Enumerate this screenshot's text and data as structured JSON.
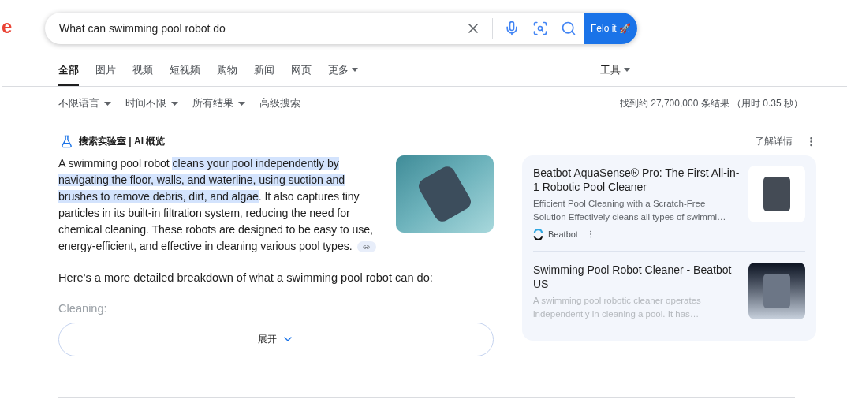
{
  "logo": "e",
  "search": {
    "value": "What can swimming pool robot do",
    "button": "Felo it 🚀"
  },
  "tabs": [
    {
      "label": "全部",
      "selected": true
    },
    {
      "label": "图片",
      "selected": false
    },
    {
      "label": "视频",
      "selected": false
    },
    {
      "label": "短视频",
      "selected": false
    },
    {
      "label": "购物",
      "selected": false
    },
    {
      "label": "新闻",
      "selected": false
    },
    {
      "label": "网页",
      "selected": false
    },
    {
      "label": "更多",
      "selected": false,
      "dropdown": true
    }
  ],
  "tools": "工具",
  "filters": [
    {
      "label": "不限语言",
      "dropdown": true
    },
    {
      "label": "时间不限",
      "dropdown": true
    },
    {
      "label": "所有结果",
      "dropdown": true
    },
    {
      "label": "高级搜索",
      "dropdown": false
    }
  ],
  "result_stats": "找到约 27,700,000 条结果 （用时 0.35 秒）",
  "ai_overview": {
    "title": "搜索实验室 | AI 概览",
    "learn_more": "了解详情",
    "segments": [
      {
        "text": "A swimming pool robot ",
        "highlighted": false
      },
      {
        "text": "cleans your pool independently by navigating the floor, walls, and waterline, using suction and brushes to remove debris, dirt, and algae",
        "highlighted": true
      },
      {
        "text": ". It also captures tiny particles in its built-in filtration system, reducing the need for chemical cleaning. These robots are designed to be easy to use, energy-efficient, and effective in cleaning various pool types.",
        "highlighted": false
      }
    ],
    "detail": "Here's a more detailed breakdown of what a swimming pool robot can do:",
    "faded_heading": "Cleaning:",
    "expand": "展开"
  },
  "sources": [
    {
      "title": "Beatbot AquaSense® Pro: The First All-in-1 Robotic Pool Cleaner",
      "snippet": "Efficient Pool Cleaning with a Scratch-Free Solution Effectively cleans all types of swimmi…",
      "site": "Beatbot",
      "faded": false,
      "kind": "light"
    },
    {
      "title": "Swimming Pool Robot Cleaner - Beatbot US",
      "snippet": "A swimming pool robotic cleaner operates independently in cleaning a pool. It has…",
      "faded": true,
      "kind": "dark"
    }
  ]
}
